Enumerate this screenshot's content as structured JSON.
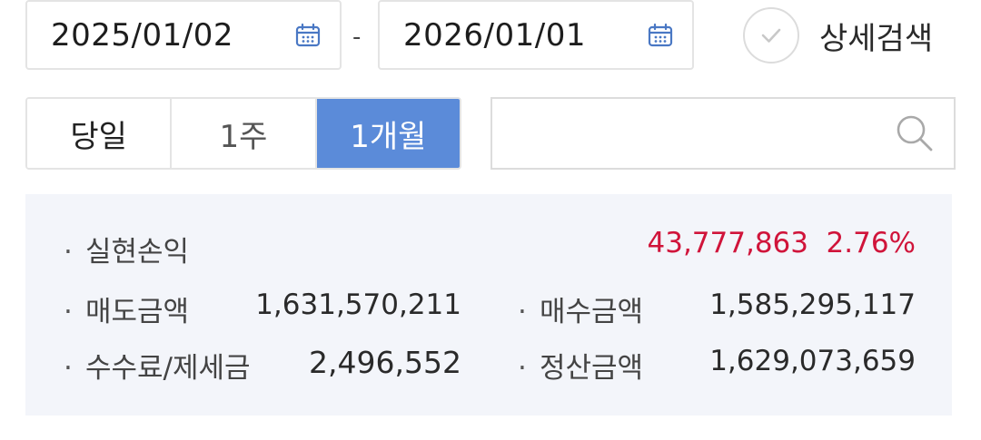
{
  "date_range": {
    "start": "2025/01/02",
    "separator": "-",
    "end": "2026/01/01"
  },
  "detail_search": {
    "label": "상세검색",
    "checked": false
  },
  "period_buttons": [
    {
      "label": "당일",
      "active": false
    },
    {
      "label": "1주",
      "active": false
    },
    {
      "label": "1개월",
      "active": true
    }
  ],
  "search": {
    "placeholder": "",
    "value": ""
  },
  "summary": {
    "bullet": "·",
    "realized_pnl": {
      "label": "실현손익",
      "amount": "43,777,863",
      "rate": "2.76%"
    },
    "sell_amount": {
      "label": "매도금액",
      "value": "1,631,570,211"
    },
    "buy_amount": {
      "label": "매수금액",
      "value": "1,585,295,117"
    },
    "fee_tax": {
      "label": "수수료/제세금",
      "value": "2,496,552"
    },
    "settle_amount": {
      "label": "정산금액",
      "value": "1,629,073,659"
    }
  },
  "colors": {
    "accent": "#5b8bd9",
    "profit_red": "#d0143a",
    "summary_bg": "#f3f5fa",
    "icon_blue": "#4a78c4"
  },
  "icons": {
    "calendar": "calendar-icon",
    "check": "check-icon",
    "search": "search-icon"
  }
}
